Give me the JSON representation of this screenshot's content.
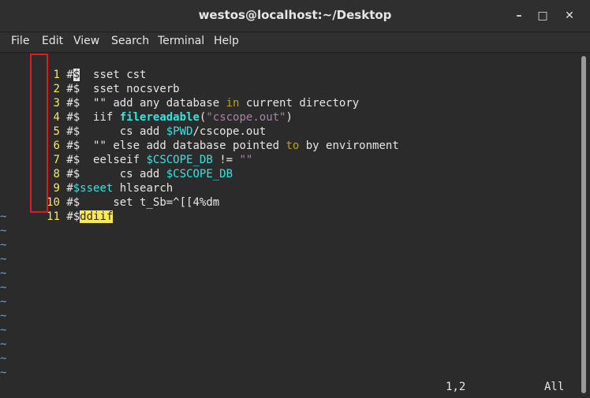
{
  "window": {
    "title": "westos@localhost:~/Desktop",
    "controls": {
      "minimize": "–",
      "maximize": "□",
      "close": "✕"
    }
  },
  "menu": [
    "File",
    "Edit",
    "View",
    "Search",
    "Terminal",
    "Help"
  ],
  "editor": {
    "lines": [
      {
        "num": "1",
        "prefix": "#",
        "cursor": "$",
        "rest": "  sset cst"
      },
      {
        "num": "2",
        "prefix": "#$",
        "rest": "  sset nocsverb"
      },
      {
        "num": "3",
        "prefix": "#$",
        "a": "  \"\" add any database ",
        "kw": "in",
        "b": " current directory"
      },
      {
        "num": "4",
        "prefix": "#$",
        "a": "  iif ",
        "fn": "filereadable",
        "b": "(",
        "str": "\"cscope.out\"",
        "c": ")"
      },
      {
        "num": "5",
        "prefix": "#$",
        "a": "      cs add ",
        "var": "$PWD",
        "b": "/cscope.out"
      },
      {
        "num": "6",
        "prefix": "#$",
        "a": "  \"\" else add database pointed ",
        "kw": "to",
        "b": " by environment"
      },
      {
        "num": "7",
        "prefix": "#$",
        "a": "  eelseif ",
        "var": "$CSCOPE_DB",
        "b": " != ",
        "str": "\"\""
      },
      {
        "num": "8",
        "prefix": "#$",
        "a": "      cs add ",
        "var": "$CSCOPE_DB"
      },
      {
        "num": "9",
        "prefix": "#",
        "cmt": "$sseet",
        "b": " hlsearch"
      },
      {
        "num": "10",
        "prefix": "#$",
        "a": "     set t_Sb=^[[4%dm"
      },
      {
        "num": "11",
        "prefix": "#$",
        "hl": "ddiif"
      }
    ],
    "tilde": "~",
    "empty_line_count": 12
  },
  "status": {
    "position": "1,2",
    "scroll": "All"
  },
  "colors": {
    "background": "#2b2b2b",
    "line_number": "#fce94f",
    "tilde": "#729fcf",
    "highlight_box": "#e01b1b"
  }
}
